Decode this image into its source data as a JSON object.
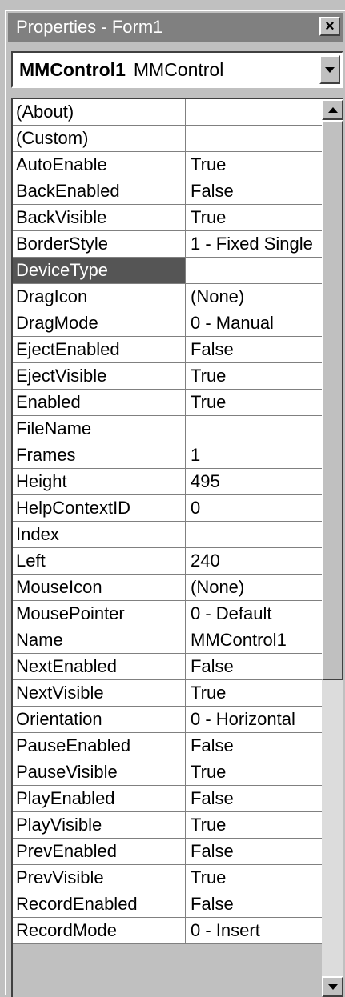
{
  "window": {
    "title": "Properties - Form1",
    "close_glyph": "×"
  },
  "object_selector": {
    "object_name": "MMControl1",
    "object_type": "MMControl"
  },
  "properties": [
    {
      "name": "(About)",
      "value": ""
    },
    {
      "name": "(Custom)",
      "value": ""
    },
    {
      "name": "AutoEnable",
      "value": "True"
    },
    {
      "name": "BackEnabled",
      "value": "False"
    },
    {
      "name": "BackVisible",
      "value": "True"
    },
    {
      "name": "BorderStyle",
      "value": "1 - Fixed Single"
    },
    {
      "name": "DeviceType",
      "value": ""
    },
    {
      "name": "DragIcon",
      "value": "(None)"
    },
    {
      "name": "DragMode",
      "value": "0 - Manual"
    },
    {
      "name": "EjectEnabled",
      "value": "False"
    },
    {
      "name": "EjectVisible",
      "value": "True"
    },
    {
      "name": "Enabled",
      "value": "True"
    },
    {
      "name": "FileName",
      "value": ""
    },
    {
      "name": "Frames",
      "value": "1"
    },
    {
      "name": "Height",
      "value": "495"
    },
    {
      "name": "HelpContextID",
      "value": "0"
    },
    {
      "name": "Index",
      "value": ""
    },
    {
      "name": "Left",
      "value": "240"
    },
    {
      "name": "MouseIcon",
      "value": "(None)"
    },
    {
      "name": "MousePointer",
      "value": "0 - Default"
    },
    {
      "name": "Name",
      "value": "MMControl1"
    },
    {
      "name": "NextEnabled",
      "value": "False"
    },
    {
      "name": "NextVisible",
      "value": "True"
    },
    {
      "name": "Orientation",
      "value": "0 - Horizontal"
    },
    {
      "name": "PauseEnabled",
      "value": "False"
    },
    {
      "name": "PauseVisible",
      "value": "True"
    },
    {
      "name": "PlayEnabled",
      "value": "False"
    },
    {
      "name": "PlayVisible",
      "value": "True"
    },
    {
      "name": "PrevEnabled",
      "value": "False"
    },
    {
      "name": "PrevVisible",
      "value": "True"
    },
    {
      "name": "RecordEnabled",
      "value": "False"
    },
    {
      "name": "RecordMode",
      "value": "0 - Insert"
    }
  ],
  "selected_property": "DeviceType"
}
